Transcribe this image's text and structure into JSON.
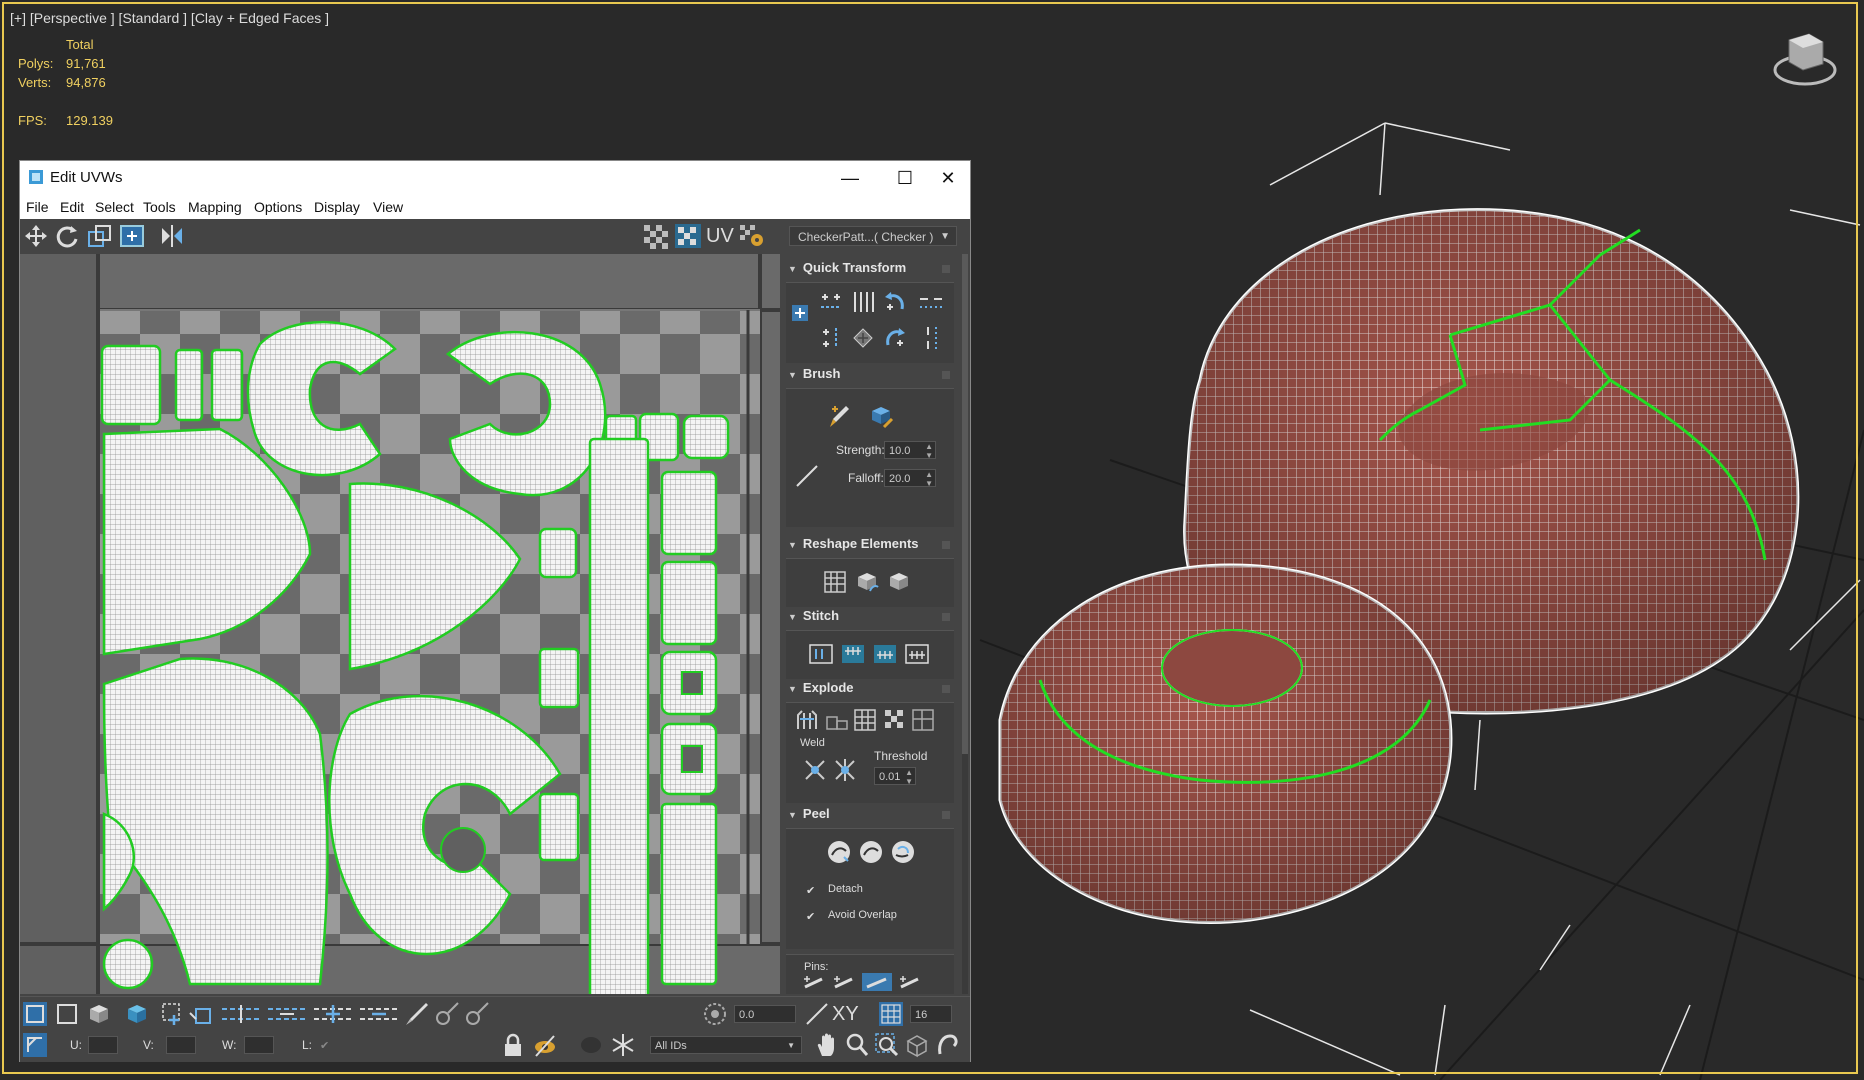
{
  "viewport": {
    "label": "[+] [Perspective ] [Standard ] [Clay + Edged Faces ]",
    "stats": {
      "total_label": "Total",
      "polys_label": "Polys:",
      "polys_value": "91,761",
      "verts_label": "Verts:",
      "verts_value": "94,876",
      "fps_label": "FPS:",
      "fps_value": "129.139"
    },
    "colors": {
      "border": "#e8c850",
      "stats": "#f0d060",
      "mesh": "#a85a50",
      "seam": "#22dd22"
    }
  },
  "uvw_window": {
    "title": "Edit UVWs",
    "title_icon": "edit-uvw-app-icon",
    "controls": {
      "minimize": "—",
      "maximize": "☐",
      "close": "✕"
    },
    "menu": [
      "File",
      "Edit",
      "Select",
      "Tools",
      "Mapping",
      "Options",
      "Display",
      "View"
    ],
    "toolbar": {
      "uv_label": "UV",
      "texture_dropdown": "CheckerPatt...( Checker )"
    },
    "rollouts": {
      "quick_transform": "Quick Transform",
      "brush": "Brush",
      "strength_label": "Strength:",
      "strength_value": "10.0",
      "falloff_label": "Falloff:",
      "falloff_value": "20.0",
      "reshape": "Reshape Elements",
      "stitch": "Stitch",
      "explode": "Explode",
      "weld_label": "Weld",
      "threshold_label": "Threshold",
      "threshold_value": "0.01",
      "peel": "Peel",
      "detach_label": "Detach",
      "avoid_overlap_label": "Avoid Overlap",
      "pins_label": "Pins:"
    },
    "bottom": {
      "spinner_value": "0.0",
      "xy_label": "XY",
      "grid_value": "16",
      "u_label": "U:",
      "v_label": "V:",
      "w_label": "W:",
      "l_label": "L:",
      "ids_dropdown": "All IDs"
    }
  }
}
